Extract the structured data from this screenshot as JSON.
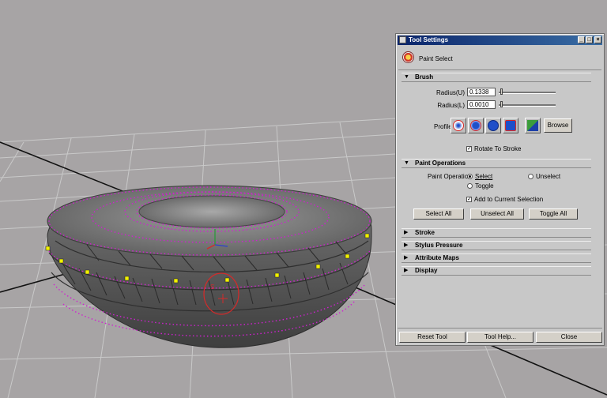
{
  "window": {
    "title": "Tool Settings",
    "tool_name": "Paint Select",
    "minimize_glyph": "_",
    "maximize_glyph": "□",
    "close_glyph": "×"
  },
  "sections": {
    "brush": {
      "label": "Brush",
      "radius_u_label": "Radius(U)",
      "radius_u_value": "0.1338",
      "radius_l_label": "Radius(L)",
      "radius_l_value": "0.0010",
      "profile_label": "Profile",
      "browse_label": "Browse",
      "rotate_label": "Rotate To Stroke",
      "rotate_checked": true
    },
    "paint_operations": {
      "label": "Paint Operations",
      "op_label": "Paint Operation",
      "select_label": "Select",
      "unselect_label": "Unselect",
      "toggle_label": "Toggle",
      "add_label": "Add to Current Selection",
      "select_all": "Select All",
      "unselect_all": "Unselect All",
      "toggle_all": "Toggle All"
    },
    "collapsed": [
      "Stroke",
      "Stylus Pressure",
      "Attribute Maps",
      "Display"
    ]
  },
  "footer": {
    "reset": "Reset Tool",
    "help": "Tool Help...",
    "close": "Close"
  },
  "colors": {
    "accent_red": "#d42a2a",
    "brush_blue": "#1f4fc9",
    "vertex_magenta": "#d020d0",
    "vertex_yellow": "#f2f200"
  },
  "icons": {
    "expanded": "▼",
    "collapsed": "▶"
  }
}
